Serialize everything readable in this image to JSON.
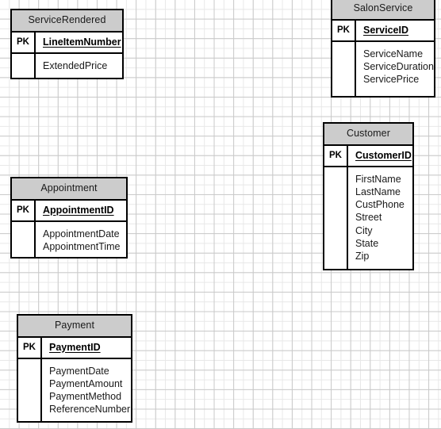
{
  "diagram": {
    "type": "entity-relationship-diagram",
    "background": "graph-paper-grid",
    "colors": {
      "header_fill": "#cccccc",
      "border": "#000000",
      "body_fill": "#ffffff",
      "grid_minor": "#e8e8e8",
      "grid_major": "#c9c9c9",
      "text": "#1a1a1a"
    },
    "key_label": "PK",
    "entities": [
      {
        "id": "servicerendered",
        "name": "ServiceRendered",
        "key_label": "PK",
        "primary_key": "LineItemNumber",
        "attributes": [
          "ExtendedPrice"
        ]
      },
      {
        "id": "salonservice",
        "name": "SalonService",
        "key_label": "PK",
        "primary_key": "ServiceID",
        "attributes": [
          "ServiceName",
          "ServiceDuration",
          "ServicePrice"
        ]
      },
      {
        "id": "customer",
        "name": "Customer",
        "key_label": "PK",
        "primary_key": "CustomerID",
        "attributes": [
          "FirstName",
          "LastName",
          "CustPhone",
          "Street",
          "City",
          "State",
          "Zip"
        ]
      },
      {
        "id": "appointment",
        "name": "Appointment",
        "key_label": "PK",
        "primary_key": "AppointmentID",
        "attributes": [
          "AppointmentDate",
          "AppointmentTime"
        ]
      },
      {
        "id": "payment",
        "name": "Payment",
        "key_label": "PK",
        "primary_key": "PaymentID",
        "attributes": [
          "PaymentDate",
          "PaymentAmount",
          "PaymentMethod",
          "ReferenceNumber"
        ]
      }
    ]
  }
}
